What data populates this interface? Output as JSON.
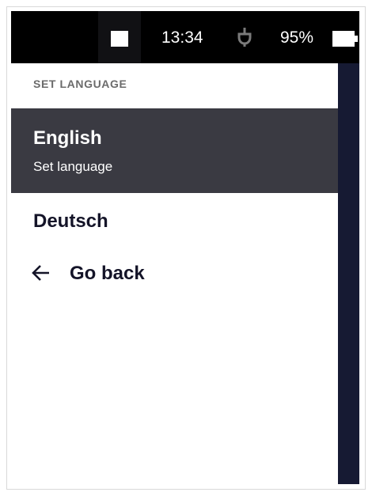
{
  "status_bar": {
    "square_icon": "square-icon",
    "time": "13:34",
    "plug_icon": "power-plug-icon",
    "battery_percent": "95%",
    "battery_icon": "battery-icon",
    "battery_level": 0.95
  },
  "menu": {
    "header": "SET LANGUAGE",
    "selected_item": {
      "title": "English",
      "subtitle": "Set language"
    },
    "items": [
      {
        "label": "Deutsch"
      }
    ],
    "back": {
      "icon": "arrow-left-icon",
      "label": "Go back"
    }
  },
  "colors": {
    "status_bar_bg": "#000000",
    "selected_bg": "#3a3a42",
    "right_strip": "#161a33",
    "text_dark": "#141428",
    "header_text": "#6b6b6b"
  }
}
